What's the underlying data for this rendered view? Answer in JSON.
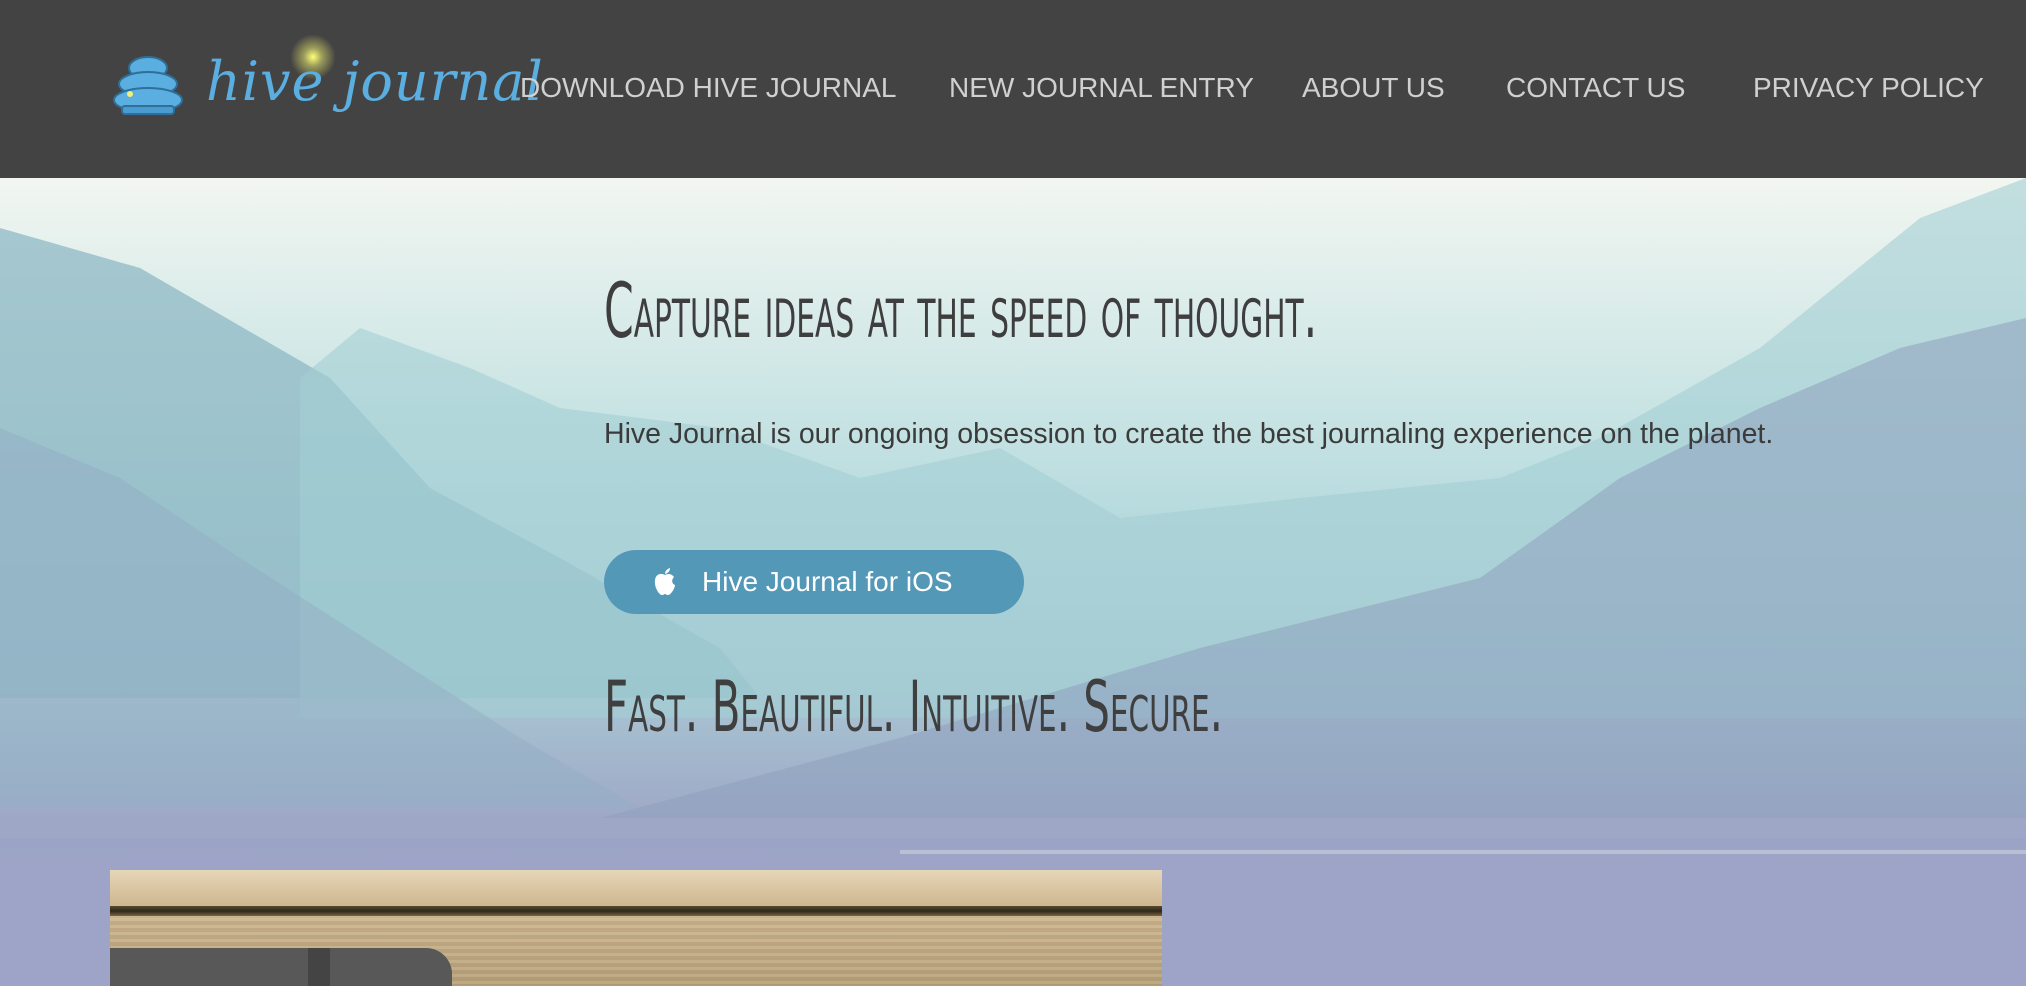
{
  "header": {
    "logo_text": "hive journal",
    "nav": [
      {
        "label": "DOWNLOAD HIVE JOURNAL"
      },
      {
        "label": "NEW JOURNAL ENTRY"
      },
      {
        "label": "ABOUT US"
      },
      {
        "label": "CONTACT US"
      },
      {
        "label": "PRIVACY POLICY"
      }
    ]
  },
  "hero": {
    "headline": "Capture ideas at the speed of thought.",
    "intro": "Hive Journal is our ongoing obsession to create the best journaling experience on the planet.",
    "ios_button_label": "Hive Journal for iOS",
    "ios_button_icon": "apple-icon",
    "tagline": "Fast. Beautiful. Intuitive. Secure."
  },
  "colors": {
    "header_bg": "#434343",
    "nav_text": "#d0d0d0",
    "button_bg": "#5498b8",
    "logo_blue": "#5aaee0",
    "heading_text": "#3e3e3e"
  }
}
